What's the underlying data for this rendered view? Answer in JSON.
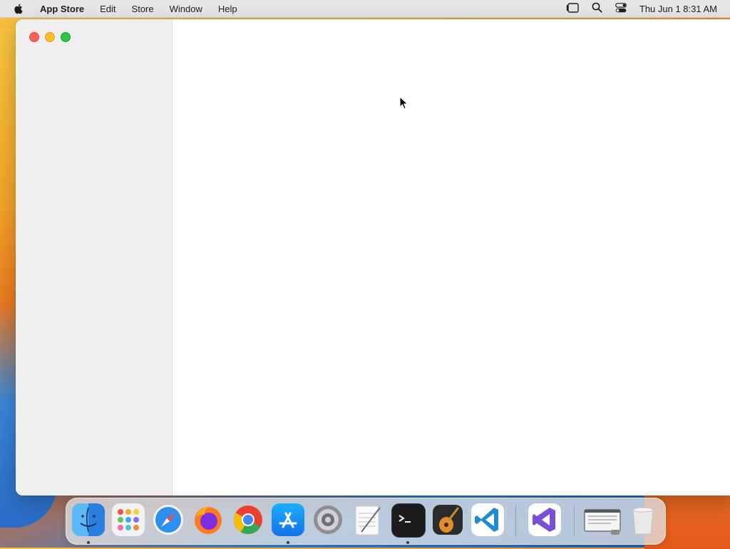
{
  "menubar": {
    "app_name": "App Store",
    "items": [
      "Edit",
      "Store",
      "Window",
      "Help"
    ],
    "clock": "Thu Jun 1  8:31 AM"
  },
  "dock": {
    "apps": [
      "Finder",
      "Launchpad",
      "Safari",
      "Firefox",
      "Google Chrome",
      "App Store",
      "System Settings",
      "TextEdit",
      "Terminal",
      "GarageBand",
      "Visual Studio Code",
      "Visual Studio",
      "Screen Preview",
      "Trash"
    ]
  },
  "colors": {
    "close": "#ff5f57",
    "minimize": "#febc2e",
    "maximize": "#28c840"
  }
}
